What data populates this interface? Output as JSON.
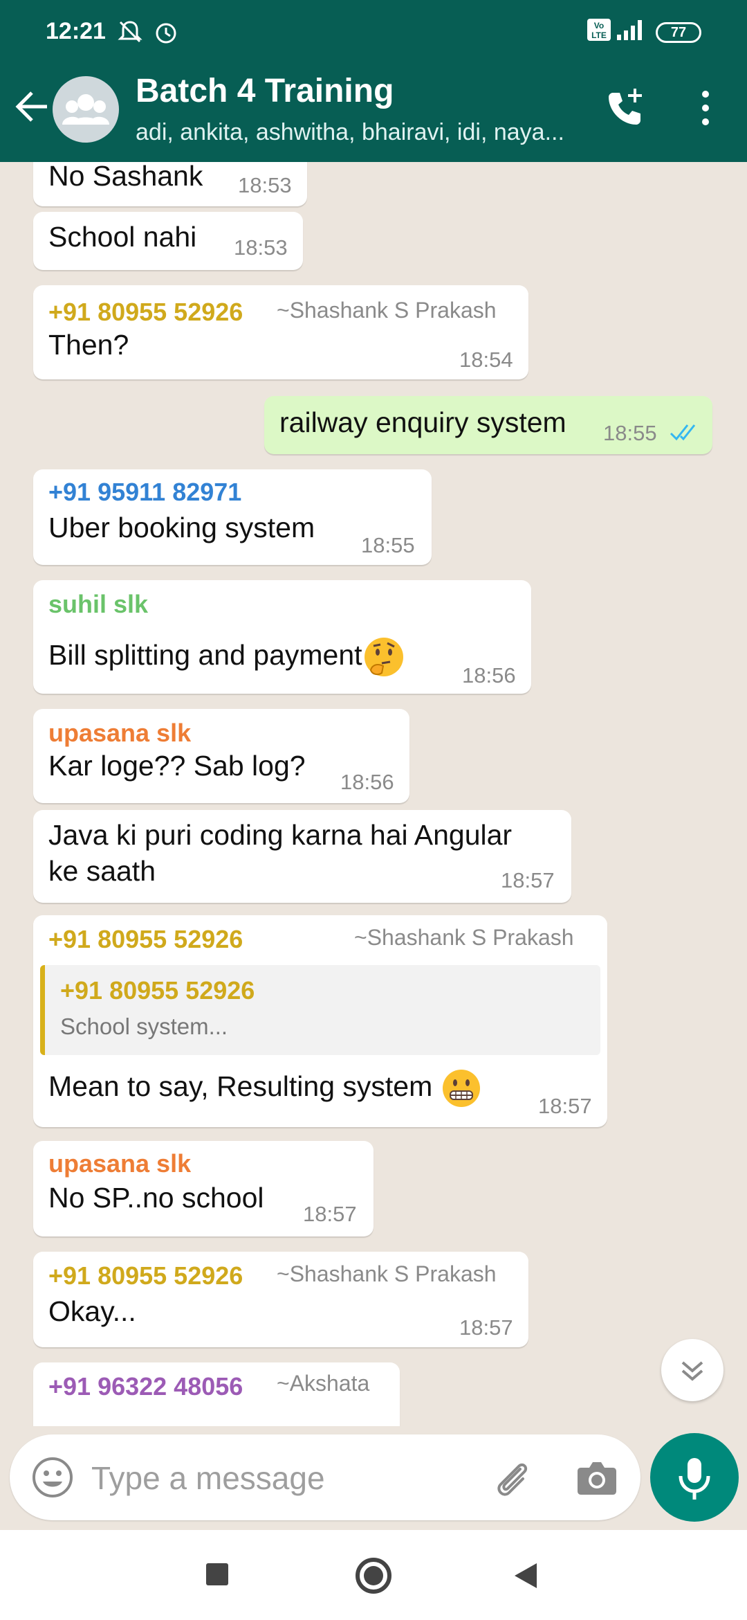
{
  "status_bar": {
    "time": "12:21",
    "battery": "77",
    "icons": [
      "mute-icon",
      "alarm-icon",
      "volte-icon",
      "signal-icon",
      "battery-icon"
    ]
  },
  "header": {
    "title": "Batch 4 Training",
    "subtitle": "adi, ankita, ashwitha, bhairavi, idi, naya...",
    "icons": [
      "back-arrow-icon",
      "group-avatar-icon",
      "add-call-icon",
      "more-vert-icon"
    ]
  },
  "colors": {
    "header": "#075e54",
    "outgoing_bubble": "#dcf8c6",
    "incoming_bubble": "#ffffff",
    "mic_button": "#00897b",
    "read_ticks": "#34b7f1"
  },
  "messages": [
    {
      "text": "No Sashank",
      "time": "18:53"
    },
    {
      "text": "School nahi",
      "time": "18:53"
    },
    {
      "sender": "+91 80955 52926",
      "alias": "~Shashank S Prakash",
      "text": "Then?",
      "time": "18:54"
    },
    {
      "text": "railway enquiry system",
      "time": "18:55"
    },
    {
      "sender": "+91 95911 82971",
      "text": "Uber booking system",
      "time": "18:55"
    },
    {
      "sender": "suhil slk",
      "text": "Bill splitting and payment",
      "time": "18:56",
      "emoji": "thinking-face"
    },
    {
      "sender": "upasana slk",
      "text": "Kar loge?? Sab log?",
      "time": "18:56"
    },
    {
      "text_line1": "Java ki puri coding karna hai Angular",
      "text_line2": "ke saath",
      "time": "18:57"
    },
    {
      "sender": "+91 80955 52926",
      "alias": "~Shashank S Prakash",
      "quote_sender": "+91 80955 52926",
      "quote_text": "School system...",
      "text": "Mean to say, Resulting system",
      "time": "18:57",
      "emoji": "grimacing-face"
    },
    {
      "sender": "upasana slk",
      "text": "No SP..no school",
      "time": "18:57"
    },
    {
      "sender": "+91 80955 52926",
      "alias": "~Shashank S Prakash",
      "text": "Okay...",
      "time": "18:57"
    },
    {
      "sender": "+91 96322 48056",
      "alias": "~Akshata"
    }
  ],
  "input": {
    "placeholder": "Type a message",
    "icons": [
      "emoji-icon",
      "attach-icon",
      "camera-icon",
      "mic-icon"
    ]
  },
  "nav": {
    "icons": [
      "recents-icon",
      "home-icon",
      "back-icon"
    ]
  }
}
